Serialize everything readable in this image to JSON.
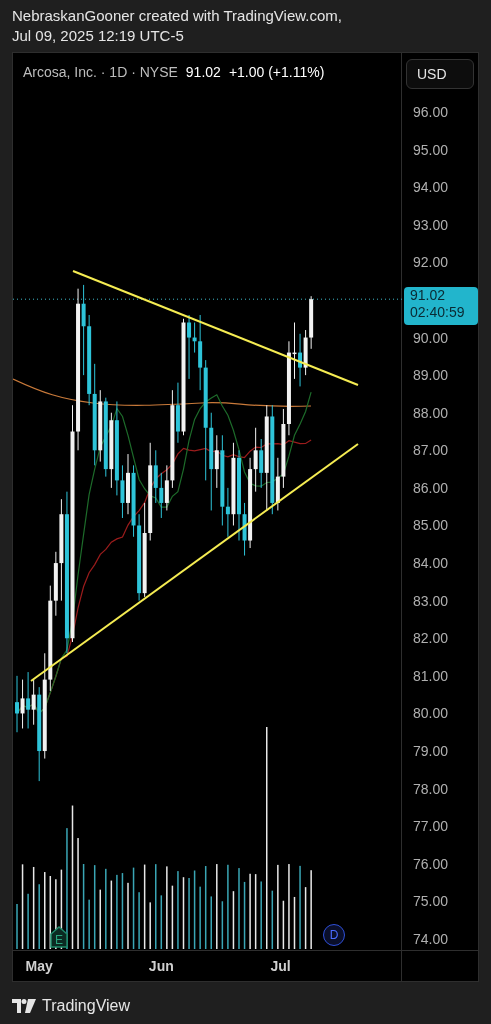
{
  "header": {
    "lines": [
      "NebraskanGooner created with TradingView.com,",
      "Jul 09, 2025 12:19 UTC-5"
    ]
  },
  "legend": {
    "symbol": "Arcosa, Inc. · 1D · NYSE",
    "price": "91.02",
    "change": "+1.00 (+1.11%)"
  },
  "currency_button": {
    "label": "USD"
  },
  "price_axis": {
    "labels": [
      "96.00",
      "95.00",
      "94.00",
      "93.00",
      "92.00",
      "90.00",
      "89.00",
      "88.00",
      "87.00",
      "86.00",
      "85.00",
      "84.00",
      "83.00",
      "82.00",
      "81.00",
      "80.00",
      "79.00",
      "78.00",
      "77.00",
      "76.00",
      "75.00",
      "74.00"
    ]
  },
  "last_price": {
    "price": "91.02",
    "countdown": "02:40:59"
  },
  "time_axis": {
    "labels": [
      "May",
      "Jun",
      "Jul"
    ]
  },
  "markers": [
    {
      "kind": "earnings",
      "label": "E"
    },
    {
      "kind": "dividend",
      "label": "D"
    }
  ],
  "footer": {
    "brand": "TradingView"
  }
}
